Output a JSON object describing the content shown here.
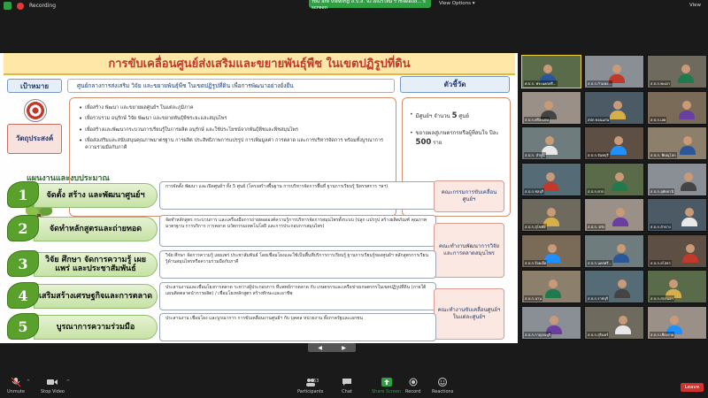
{
  "topbar": {
    "recording_label": "Recording",
    "viewing_banner": "You are viewing ส.ป.ส. จะวัดแร่ใหม่ ราชจัดดังส...'s screen",
    "view_options": "View Options",
    "view_label": "View"
  },
  "slide": {
    "title": "การขับเคลื่อนศูนย์ส่งเสริมและขยายพันธุ์พืช ในเขตปฏิรูปที่ดิน",
    "goal_label": "เป้าหมาย",
    "center_line": "ศูนย์กลางการส่งเสริม วิจัย และขยายพันธุ์พืช ในเขตปฏิรูปที่ดิน เพื่อการพัฒนาอย่างยั่งยืน",
    "indicator_label": "ตัวชี้วัด",
    "objective_label": "วัตถุประสงค์",
    "objectives": [
      "เพื่อสร้าง พัฒนา และขยายผลศูนย์ฯ ในแต่ละภูมิภาค",
      "เพื่อรวบรวม อนุรักษ์ วิจัย พัฒนา และขยายพันธุ์พืชระยะและสมุนไพร",
      "เพื่อสร้างและพัฒนากระบวนการเรียนรู้ในการผลิต อนุรักษ์ และใช้ประโยชน์จากพันธุ์พืชและพืชสมุนไพร",
      "เพื่อส่งเสริมและสนับสนุนคุณภาพมาตรฐาน การผลิต ประสิทธิภาพการแปรรูป การเพิ่มมูลค่า การตลาด และการบริหารจัดการ พร้อมทั้งบูรณาการความร่วมมือกับภาคี"
    ],
    "indicators": [
      {
        "prefix": "มีศูนย์ฯ จำนวน ",
        "value": "5",
        "suffix": " ศูนย์"
      },
      {
        "prefix": "ขยายผลสู่เกษตรกรหรือผู้ที่สนใจ ปีละ ",
        "value": "500",
        "suffix": " ราย"
      }
    ],
    "plan_heading": "แผนงานและงบประมาณ",
    "plans": [
      {
        "number": "1",
        "title": "จัดตั้ง สร้าง และพัฒนาศูนย์ฯ",
        "description": "การจัดตั้ง พัฒนา และเปิดศูนย์ฯ ทั้ง 5 ศูนย์ (โครงสร้างพื้นฐาน การบริหารจัดการพื้นที่ ฐานการเรียนรู้ นิทรรศการ ฯลฯ)",
        "org": "คณะกรรมการขับเคลื่อนศูนย์ฯ"
      },
      {
        "number": "2",
        "title": "จัดทำหลักสูตรและถ่ายทอด",
        "description": "จัดทำหลักสูตร กระบวนการ และเครื่องมือการถ่ายทอดองค์ความรู้การบริหารจัดการสมุนไพรทั้งระบบ (ปลูก แปรรูป สร้างผลิตภัณฑ์ คุณภาพมาตรฐาน การบริการ การตลาด นวัตกรรมเทคโนโลยี และการประกอบการสมุนไพร)",
        "org": "คณะทำงานพัฒนาการวิจัย และการตลาดสมุนไพร"
      },
      {
        "number": "3",
        "title": "วิจัย ศึกษา จัดการความรู้ เผยแพร่ และประชาสัมพันธ์",
        "description": "วิจัย ศึกษา จัดการความรู้ เผยแพร่ ประชาสัมพันธ์ โดยเชื่อมโยงและใช้เป็นพื้นที่บริการการเรียนรู้ ฐานการเรียนรู้ของศูนย์ฯ หลักสูตรการเรียนรู้ด้านสมุนไพรหรือความร่วมมือกับภาคี",
        "org": ""
      },
      {
        "number": "4",
        "title": "เสริมสร้างเศรษฐกิจและการตลาด",
        "description": "ประสานงานและเชื่อมโยงการตลาด ระหว่างผู้ประกอบการ ที่แพทย์การตลาด กับ เกษตรกรและเครือข่ายเกษตรกรในเขตปฏิรูปที่ดิน (ภายใต้แผนติดตลาดนำการผลิต) / เชื่อมโยงหลักสูตร สร้างทักษะและอาชีพ",
        "org": "คณะทำงานขับเคลื่อนศูนย์ฯ ในแต่ละศูนย์ฯ"
      },
      {
        "number": "5",
        "title": "บูรณาการความร่วมมือ",
        "description": "ประสานงาน เชื่อมโยง และบูรณาการ การขับเคลื่อนงานศูนย์ฯ กับ บุคคล หน่วยงาน ทั้งภาครัฐและเอกชน",
        "org": ""
      }
    ]
  },
  "gallery": {
    "tiles": [
      {
        "name": "ศ.ป.ก. พระนครศรี..."
      },
      {
        "name": "ส.ป.ก.กำแพง..."
      },
      {
        "name": "ส.ป.ก.พะเยา"
      },
      {
        "name": "ส.ป.ก.ศรีสะเกษ"
      },
      {
        "name": "สปก.ขอนแก่น"
      },
      {
        "name": "ส.ป.ก.เลย"
      },
      {
        "name": "ส.ป.ก. ลำพูน"
      },
      {
        "name": "ส.ป.ก.จันทบุรี"
      },
      {
        "name": "ส.ป.ก. พิษณุโลก"
      },
      {
        "name": "ส.ป.ก.ชลบุรี"
      },
      {
        "name": "ส.ป.ก.ตาก"
      },
      {
        "name": "ส.ป.ก.อุทัยธานี"
      },
      {
        "name": "ส.ป.ก.สุโขทัย"
      },
      {
        "name": "ส.ป.ก. ตรัง"
      },
      {
        "name": "ส.ป.ก.ลำปาง"
      },
      {
        "name": "ส.ป.ก.ร้อยเอ็ด"
      },
      {
        "name": "ส.ป.ก.นครศรี..."
      },
      {
        "name": "ส.ป.ก.ยโสธร"
      },
      {
        "name": "ส.ป.ก.น่าน"
      },
      {
        "name": "ส.ป.ก.ราชบุรี"
      },
      {
        "name": "ส.ป.ก.สกลนคร"
      },
      {
        "name": "ส.ป.ก.กาญจนบุรี"
      },
      {
        "name": "ส.ป.ก.สุรินทร์"
      },
      {
        "name": "ส.ป.ก.เชียงราย"
      },
      {
        "name": "ส.ป.ก.ระยอง"
      },
      {
        "name": "ส.ป.ก.สระแก้ว"
      },
      {
        "name": "ส.ป.ก.มุกดาหาร"
      },
      {
        "name": "ส.ป.ก.แพร่"
      },
      {
        "name": "ส.ป.ก.ชัยนาท"
      },
      {
        "name": "ส.ป.ก.อุบลราชธานี"
      },
      {
        "name": "ส.ป.ก.อ่างทอง"
      },
      {
        "name": "ส.ป.ก.ตราด"
      },
      {
        "name": "ส.ป.ก.ปราจีนบุรี"
      },
      {
        "name": "ส.ป.ก.ชุมพร"
      },
      {
        "name": "ส.ป.ก.พัทลุง"
      },
      {
        "name": "ส.ป.ก.นครพนม"
      },
      {
        "name": "ส.ป.ก.ภูเก็ต"
      },
      {
        "name": "ส.ป.ก.สิงห์บุรี"
      },
      {
        "name": "ส.ป.ก.นครนายก"
      },
      {
        "name": "ส.ป.ก.เพชรบุรี"
      },
      {
        "name": "ส.ป.ก.สุราษฎร์ธานี"
      },
      {
        "name": "ส.ป.ก.สตูล"
      },
      {
        "name": "ส.ป.ก.อุดรธานี"
      },
      {
        "name": "ส.ป.ก.เพชรบูรณ์"
      },
      {
        "name": "ส.ป.ก.พังงา"
      },
      {
        "name": "ส.ป.ก.กระบี่"
      },
      {
        "name": "ส.ป.ก.ลพบุรี"
      },
      {
        "name": "ส.ป.ก.สระบุรี"
      },
      {
        "name": "ส.ป.ก.แม่ฮ่องสอน"
      },
      {
        "name": "ส.ป.ก.ยะลา"
      },
      {
        "name": "ส.ป.ก.หนองคาย"
      },
      {
        "name": "ส.ป.ก.ประจวบฯ"
      },
      {
        "name": "ส.ป.ก.ชัยภูมิ"
      },
      {
        "name": "ส.ป.ก.บุรีรัมย์"
      },
      {
        "name": "ส.ป.ก.นราธิวาส"
      },
      {
        "name": "ส.ป.ก.อุตรดิตถ์"
      },
      {
        "name": "ส.ป.ก.มหาสารคาม"
      },
      {
        "name": "ส.ป.ก.กาฬสินธุ์"
      },
      {
        "name": "ส.ป.ก.เชียงใหม่"
      },
      {
        "name": "Kittisara"
      }
    ]
  },
  "pres_nav": {
    "prev": "◀",
    "next": "▶"
  },
  "toolbar": {
    "unmute": "Unmute",
    "stop_video": "Stop Video",
    "participants": "Participants",
    "participants_count": "63",
    "chat": "Chat",
    "share_screen": "Share Screen",
    "record": "Record",
    "reactions": "Reactions",
    "leave": "Leave"
  },
  "colors": {
    "accent_green": "#2ea043",
    "leave_red": "#d0312d",
    "title_red": "#c0392b",
    "leaf_green": "#5aa02c"
  }
}
